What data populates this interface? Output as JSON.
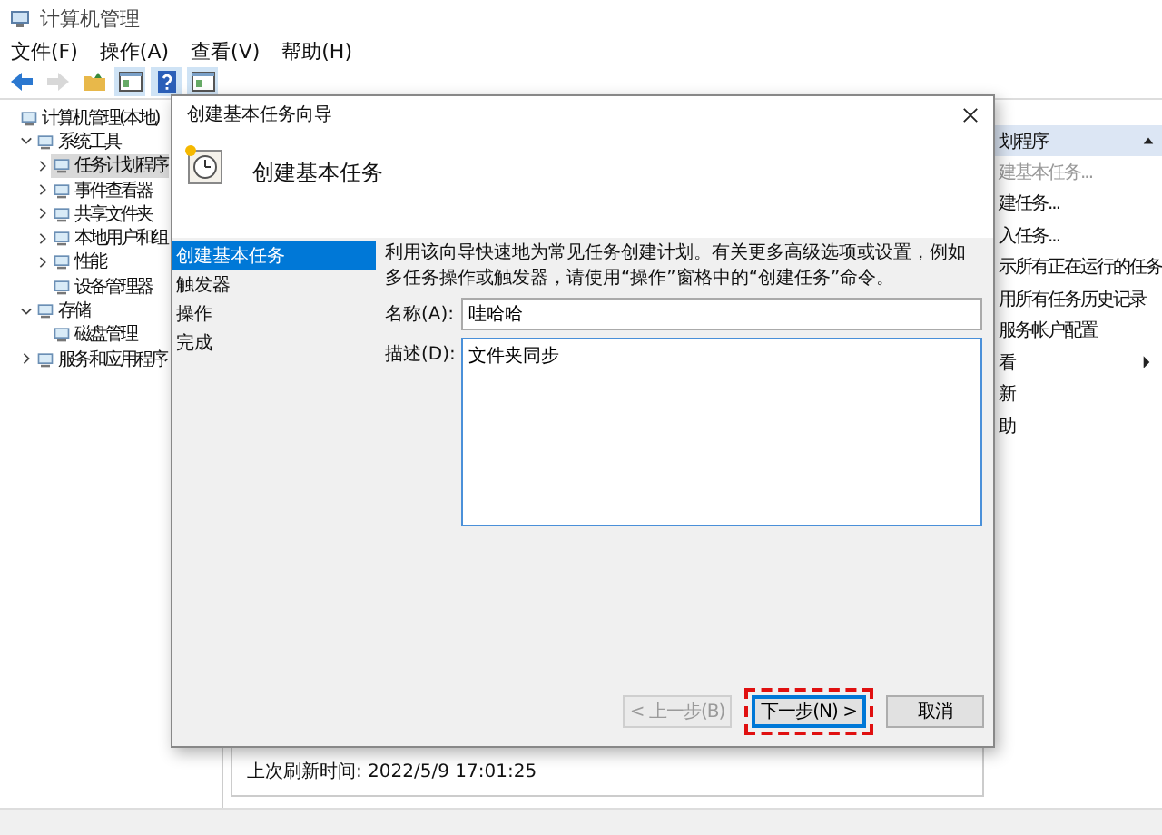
{
  "window": {
    "title": "计算机管理"
  },
  "menu": [
    "文件(F)",
    "操作(A)",
    "查看(V)",
    "帮助(H)"
  ],
  "toolbar": [
    {
      "kind": "back",
      "disabled": false
    },
    {
      "kind": "forward",
      "disabled": true
    },
    {
      "kind": "folder",
      "disabled": false
    },
    {
      "kind": "pane",
      "disabled": false
    },
    {
      "kind": "help",
      "disabled": false
    },
    {
      "kind": "pane",
      "disabled": false
    }
  ],
  "tree": [
    {
      "label": "计算机管理(本地)",
      "selected": false,
      "children": [
        {
          "label": "系统工具",
          "expanded": true,
          "selected": false,
          "children": [
            {
              "label": "任务计划程序",
              "expanded": false,
              "selected": true
            },
            {
              "label": "事件查看器",
              "expanded": false,
              "selected": false
            },
            {
              "label": "共享文件夹",
              "expanded": false,
              "selected": false
            },
            {
              "label": "本地用户和组",
              "expanded": false,
              "selected": false
            },
            {
              "label": "性能",
              "expanded": false,
              "selected": false
            },
            {
              "label": "设备管理器",
              "selected": false
            }
          ]
        },
        {
          "label": "存储",
          "expanded": true,
          "selected": false,
          "children": [
            {
              "label": "磁盘管理",
              "selected": false
            }
          ]
        },
        {
          "label": "服务和应用程序",
          "expanded": false,
          "selected": false
        }
      ]
    }
  ],
  "center": {
    "status": "上次刷新时间: 2022/5/9 17:01:25"
  },
  "actions": {
    "header": "划程序",
    "expanded": true,
    "items": [
      {
        "label": "建基本任务...",
        "disabled": true,
        "submenu": false
      },
      {
        "label": "建任务...",
        "disabled": false,
        "submenu": false
      },
      {
        "label": "入任务...",
        "disabled": false,
        "submenu": false
      },
      {
        "label": "示所有正在运行的任务",
        "disabled": false,
        "submenu": false
      },
      {
        "label": "用所有任务历史记录",
        "disabled": false,
        "submenu": false
      },
      {
        "label": "服务帐户配置",
        "disabled": false,
        "submenu": false
      },
      {
        "label": "看",
        "disabled": false,
        "submenu": true
      },
      {
        "label": "新",
        "disabled": false,
        "submenu": false
      },
      {
        "label": "助",
        "disabled": false,
        "submenu": false
      }
    ]
  },
  "dialog": {
    "title": "创建基本任务向导",
    "heading": "创建基本任务",
    "steps": [
      {
        "label": "创建基本任务",
        "selected": true
      },
      {
        "label": "触发器",
        "selected": false
      },
      {
        "label": "操作",
        "selected": false
      },
      {
        "label": "完成",
        "selected": false
      }
    ],
    "intro": "利用该向导快速地为常见任务创建计划。有关更多高级选项或设置，例如多任务操作或触发器，请使用“操作”窗格中的“创建任务”命令。",
    "fields": [
      {
        "label": "名称(A):",
        "value": "哇哈哈",
        "kind": "line",
        "focused": false
      },
      {
        "label": "描述(D):",
        "value": "文件夹同步",
        "kind": "multiline",
        "focused": true
      }
    ],
    "buttons": [
      {
        "label": "< 上一步(B)",
        "disabled": true,
        "default": false,
        "highlighted": false
      },
      {
        "label": "下一步(N) >",
        "disabled": false,
        "default": true,
        "highlighted": true
      },
      {
        "label": "取消",
        "disabled": false,
        "default": false,
        "highlighted": false
      }
    ]
  }
}
